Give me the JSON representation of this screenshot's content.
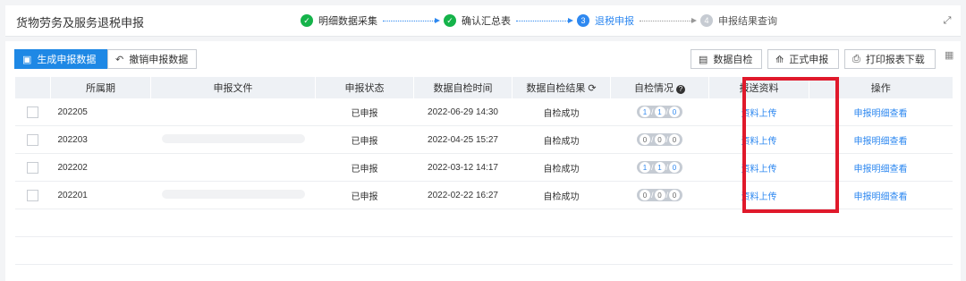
{
  "header": {
    "title": "货物劳务及服务退税申报",
    "steps": [
      {
        "num": "✓",
        "label": "明细数据采集",
        "state": "done"
      },
      {
        "num": "✓",
        "label": "确认汇总表",
        "state": "done"
      },
      {
        "num": "3",
        "label": "退税申报",
        "state": "active"
      },
      {
        "num": "4",
        "label": "申报结果查询",
        "state": "todo"
      }
    ]
  },
  "toolbar": {
    "generate_label": "生成申报数据",
    "revoke_label": "撤销申报数据",
    "check_label": "数据自检",
    "formal_label": "正式申报",
    "print_label": "打印报表下载"
  },
  "table": {
    "headers": [
      "所属期",
      "申报文件",
      "申报状态",
      "数据自检时间",
      "数据自检结果",
      "自检情况",
      "报送资料",
      "操作"
    ],
    "rows": [
      {
        "period": "202205",
        "status": "已申报",
        "time": "2022-06-29 14:30",
        "result": "自检成功",
        "counts": [
          "1",
          "1",
          "0"
        ],
        "pill": "blue",
        "upload": "资料上传",
        "op": "申报明细查看"
      },
      {
        "period": "202203",
        "status": "已申报",
        "time": "2022-04-25 15:27",
        "result": "自检成功",
        "counts": [
          "0",
          "0",
          "0"
        ],
        "pill": "gray",
        "upload": "资料上传",
        "op": "申报明细查看"
      },
      {
        "period": "202202",
        "status": "已申报",
        "time": "2022-03-12 14:17",
        "result": "自检成功",
        "counts": [
          "1",
          "1",
          "0"
        ],
        "pill": "blue",
        "upload": "资料上传",
        "op": "申报明细查看"
      },
      {
        "period": "202201",
        "status": "已申报",
        "time": "2022-02-22 16:27",
        "result": "自检成功",
        "counts": [
          "0",
          "0",
          "0"
        ],
        "pill": "gray",
        "upload": "资料上传",
        "op": "申报明细查看"
      }
    ]
  },
  "colors": {
    "accent": "#1e88e5",
    "done": "#15b34a",
    "highlight": "#e0192b"
  }
}
